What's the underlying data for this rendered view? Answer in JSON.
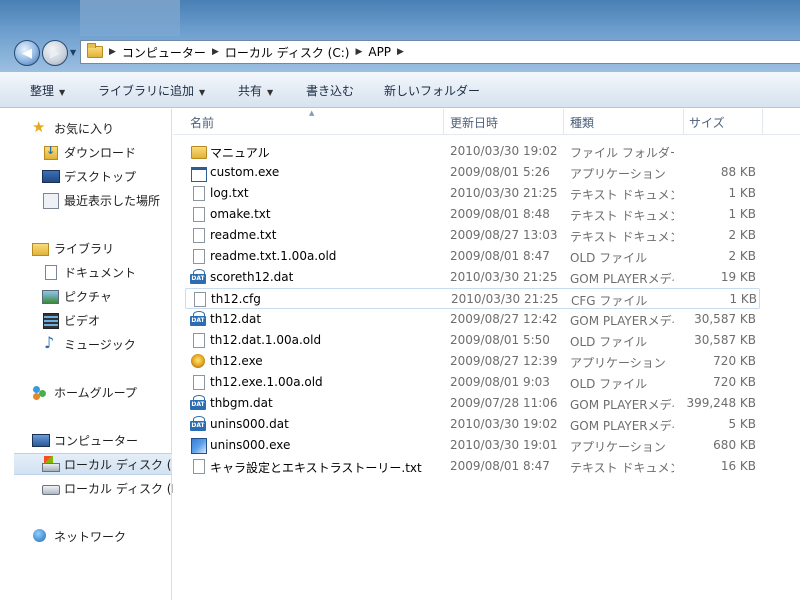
{
  "address": {
    "crumbs": [
      "コンピューター",
      "ローカル ディスク (C:)",
      "APP"
    ]
  },
  "toolbar": {
    "organize": "整理",
    "add_library": "ライブラリに追加",
    "share": "共有",
    "burn": "書き込む",
    "new_folder": "新しいフォルダー"
  },
  "nav": {
    "favorites": "お気に入り",
    "downloads": "ダウンロード",
    "desktop": "デスクトップ",
    "recent": "最近表示した場所",
    "libraries": "ライブラリ",
    "documents": "ドキュメント",
    "pictures": "ピクチャ",
    "videos": "ビデオ",
    "music": "ミュージック",
    "homegroup": "ホームグループ",
    "computer": "コンピューター",
    "local_disk_1": "ローカル ディスク (C:)",
    "local_disk_2": "ローカル ディスク (D:)",
    "network": "ネットワーク"
  },
  "columns": {
    "name": "名前",
    "date": "更新日時",
    "type": "種類",
    "size": "サイズ"
  },
  "files": [
    {
      "name": "マニュアル",
      "date": "2010/03/30 19:02",
      "type": "ファイル フォルダー",
      "size": "",
      "icon": "folder-icon"
    },
    {
      "name": "custom.exe",
      "date": "2009/08/01 5:26",
      "type": "アプリケーション",
      "size": "88 KB",
      "icon": "exe-icon"
    },
    {
      "name": "log.txt",
      "date": "2010/03/30 21:25",
      "type": "テキスト ドキュメント",
      "size": "1 KB",
      "icon": "text-file-icon"
    },
    {
      "name": "omake.txt",
      "date": "2009/08/01 8:48",
      "type": "テキスト ドキュメント",
      "size": "1 KB",
      "icon": "text-file-icon"
    },
    {
      "name": "readme.txt",
      "date": "2009/08/27 13:03",
      "type": "テキスト ドキュメント",
      "size": "2 KB",
      "icon": "text-file-icon"
    },
    {
      "name": "readme.txt.1.00a.old",
      "date": "2009/08/01 8:47",
      "type": "OLD ファイル",
      "size": "2 KB",
      "icon": "generic-file-icon"
    },
    {
      "name": "scoreth12.dat",
      "date": "2010/03/30 21:25",
      "type": "GOM PLAYERメディアファイル",
      "size": "19 KB",
      "icon": "dat-file-icon"
    },
    {
      "name": "th12.cfg",
      "date": "2010/03/30 21:25",
      "type": "CFG ファイル",
      "size": "1 KB",
      "icon": "generic-file-icon"
    },
    {
      "name": "th12.dat",
      "date": "2009/08/27 12:42",
      "type": "GOM PLAYERメディアファイル",
      "size": "30,587 KB",
      "icon": "dat-file-icon"
    },
    {
      "name": "th12.dat.1.00a.old",
      "date": "2009/08/01 5:50",
      "type": "OLD ファイル",
      "size": "30,587 KB",
      "icon": "generic-file-icon"
    },
    {
      "name": "th12.exe",
      "date": "2009/08/27 12:39",
      "type": "アプリケーション",
      "size": "720 KB",
      "icon": "game-exe-icon"
    },
    {
      "name": "th12.exe.1.00a.old",
      "date": "2009/08/01 9:03",
      "type": "OLD ファイル",
      "size": "720 KB",
      "icon": "generic-file-icon"
    },
    {
      "name": "thbgm.dat",
      "date": "2009/07/28 11:06",
      "type": "GOM PLAYERメディアファイル",
      "size": "399,248 KB",
      "icon": "dat-file-icon"
    },
    {
      "name": "unins000.dat",
      "date": "2010/03/30 19:02",
      "type": "GOM PLAYERメディアファイル",
      "size": "5 KB",
      "icon": "dat-file-icon"
    },
    {
      "name": "unins000.exe",
      "date": "2010/03/30 19:01",
      "type": "アプリケーション",
      "size": "680 KB",
      "icon": "setup-exe-icon"
    },
    {
      "name": "キャラ設定とエキストラストーリー.txt",
      "date": "2009/08/01 8:47",
      "type": "テキスト ドキュメント",
      "size": "16 KB",
      "icon": "text-file-icon"
    }
  ]
}
